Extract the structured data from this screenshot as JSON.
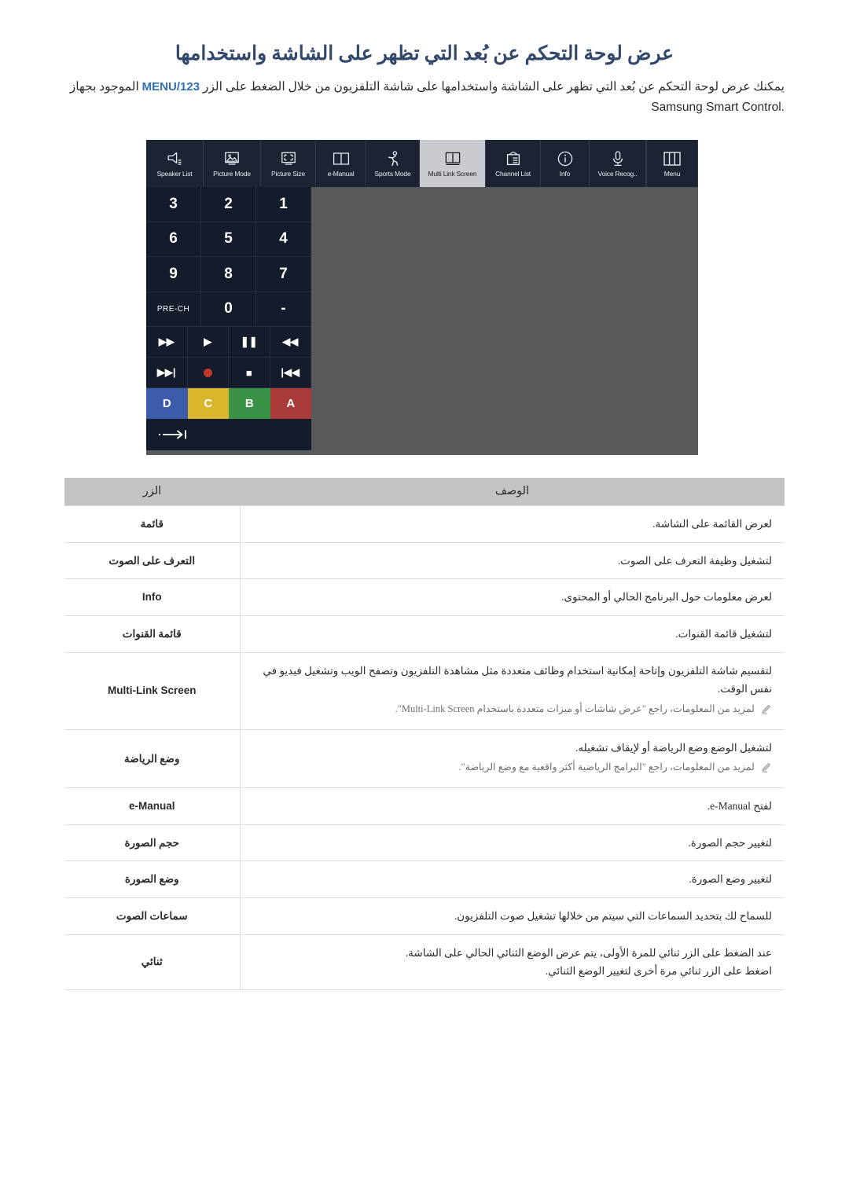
{
  "document": {
    "title": "عرض لوحة التحكم عن بُعد التي تظهر على الشاشة واستخدامها",
    "intro_before": "يمكنك عرض لوحة التحكم عن بُعد التي تظهر على الشاشة واستخدامها على شاشة التلفزيون من خلال الضغط على الزر",
    "intro_highlight": "MENU/123",
    "intro_after": "الموجود بجهاز",
    "intro_line2": "Samsung Smart Control."
  },
  "remote": {
    "toolbar": [
      {
        "label": "Menu",
        "icon": "menu-panels-icon",
        "active": false
      },
      {
        "label": "Voice Recog..",
        "icon": "microphone-icon",
        "active": false
      },
      {
        "label": "Info",
        "icon": "info-circle-icon",
        "active": false
      },
      {
        "label": "Channel List",
        "icon": "channel-list-icon",
        "active": false
      },
      {
        "label": "Multi Link Screen",
        "icon": "multi-link-screen-icon",
        "active": true
      },
      {
        "label": "Sports Mode",
        "icon": "running-person-icon",
        "active": false
      },
      {
        "label": "e-Manual",
        "icon": "open-book-icon",
        "active": false
      },
      {
        "label": "Picture Size",
        "icon": "picture-size-icon",
        "active": false
      },
      {
        "label": "Picture Mode",
        "icon": "picture-mode-icon",
        "active": false
      },
      {
        "label": "Speaker List",
        "icon": "speaker-icon",
        "active": false
      }
    ],
    "keypad_rows": [
      [
        "1",
        "2",
        "3"
      ],
      [
        "4",
        "5",
        "6"
      ],
      [
        "7",
        "8",
        "9"
      ],
      [
        "-",
        "0",
        "PRE-CH"
      ]
    ],
    "media_row_1": [
      {
        "icon": "rewind-icon",
        "glyph": "◀◀"
      },
      {
        "icon": "pause-icon",
        "glyph": "❚❚"
      },
      {
        "icon": "play-icon",
        "glyph": "▶"
      },
      {
        "icon": "fast-forward-icon",
        "glyph": "▶▶"
      }
    ],
    "media_row_2": [
      {
        "icon": "previous-track-icon",
        "glyph": "|◀◀"
      },
      {
        "icon": "stop-icon",
        "glyph": "■"
      },
      {
        "icon": "record-icon",
        "glyph": ""
      },
      {
        "icon": "next-track-icon",
        "glyph": "▶▶|"
      }
    ],
    "color_buttons": [
      {
        "label": "A",
        "color": "#a93b3b"
      },
      {
        "label": "B",
        "color": "#3a9247"
      },
      {
        "label": "C",
        "color": "#d9b62c"
      },
      {
        "label": "D",
        "color": "#3b5cab"
      }
    ],
    "exit_row": {
      "icon": "exit-arrow-icon",
      "glyph": "⇾|"
    }
  },
  "table": {
    "headers": {
      "description": "الوصف",
      "button": "الزر"
    },
    "rows": [
      {
        "button": "قائمة",
        "latin": false,
        "desc": "لعرض القائمة على الشاشة.",
        "note": ""
      },
      {
        "button": "التعرف على الصوت",
        "latin": false,
        "desc": "لتشغيل وظيفة التعرف على الصوت.",
        "note": ""
      },
      {
        "button": "Info",
        "latin": true,
        "desc": "لعرض معلومات حول البرنامج الحالي أو المحتوى.",
        "note": ""
      },
      {
        "button": "قائمة القنوات",
        "latin": false,
        "desc": "لتشغيل قائمة القنوات.",
        "note": ""
      },
      {
        "button": "Multi-Link Screen",
        "latin": true,
        "desc": "لتقسيم شاشة التلفزيون وإتاحة إمكانية استخدام وظائف متعددة مثل مشاهدة التلفزيون وتصفح الويب وتشغيل فيديو في نفس الوقت.",
        "note": "لمزيد من المعلومات، راجع \"عرض شاشات أو ميزات متعددة باستخدام Multi-Link Screen\"."
      },
      {
        "button": "وضع الرياضة",
        "latin": false,
        "desc": "لتشغيل الوضع وضع الرياضة أو لإيقاف تشغيله.",
        "note": "لمزيد من المعلومات، راجع \"البرامج الرياضية أكثر واقعية مع وضع الرياضة\"."
      },
      {
        "button": "e-Manual",
        "latin": true,
        "desc": "لفتح e-Manual.",
        "note": ""
      },
      {
        "button": "حجم الصورة",
        "latin": false,
        "desc": "لتغيير حجم الصورة.",
        "note": ""
      },
      {
        "button": "وضع الصورة",
        "latin": false,
        "desc": "لتغيير وضع الصورة.",
        "note": ""
      },
      {
        "button": "سماعات الصوت",
        "latin": false,
        "desc": "للسماح لك بتحديد السماعات التي سيتم من خلالها تشغيل صوت التلفزيون.",
        "note": ""
      },
      {
        "button": "ثنائي",
        "latin": false,
        "desc": "عند الضغط على الزر ثنائي للمرة الأولى، يتم عرض الوضع الثنائي الحالي على الشاشة.",
        "note": "اضغط على الزر ثنائي مرة أخرى لتغيير الوضع الثنائي."
      }
    ]
  },
  "colors": {
    "heading": "#31476b",
    "link": "#2f6fb5",
    "panel_bg": "#58595b",
    "toolbar_bg": "#1c2333",
    "keypad_bg": "#141b2b",
    "table_header_bg": "#c2c3c5"
  }
}
